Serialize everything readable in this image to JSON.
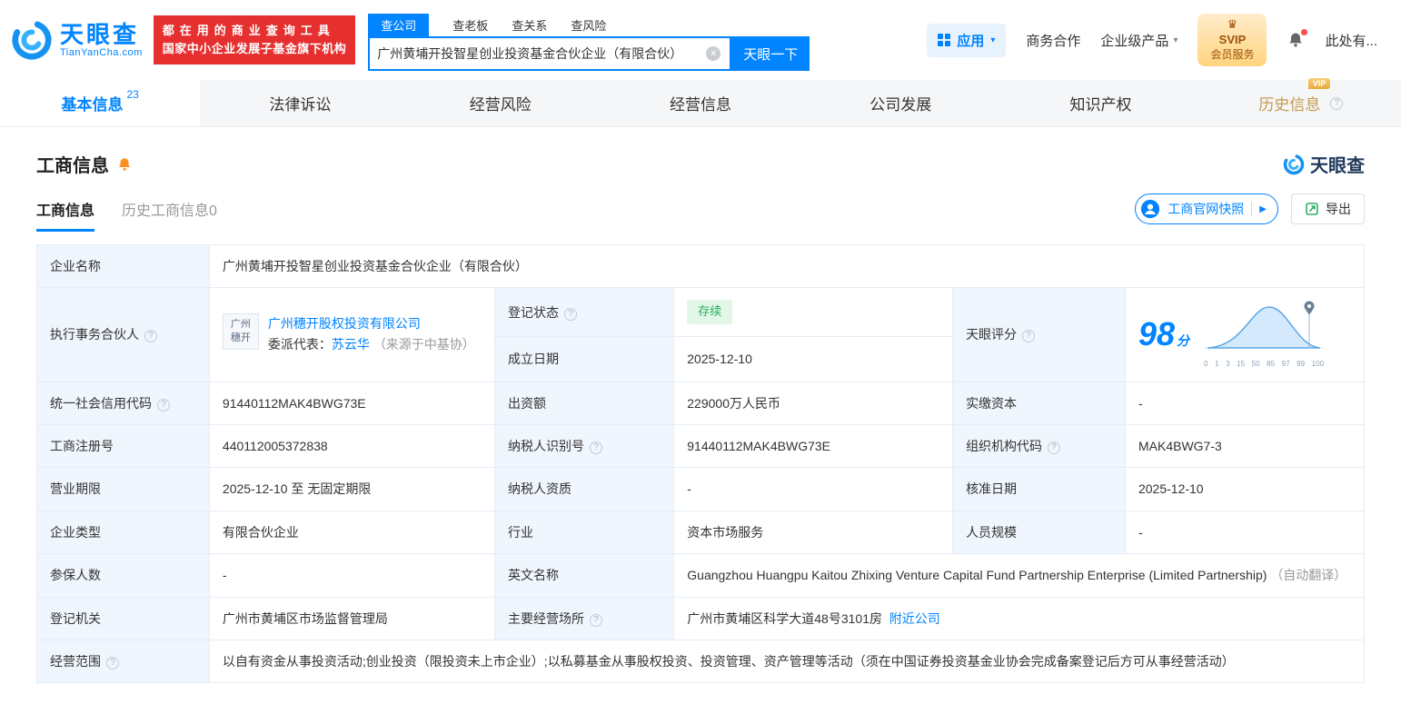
{
  "brand": {
    "name_cn": "天眼查",
    "name_en": "TianYanCha.com"
  },
  "icons": {
    "help": "?",
    "clear": "✕",
    "caret": "▾",
    "snapshot_arrow": "▶",
    "crown": "♛"
  },
  "header": {
    "banner_line1": "都在用的商业查询工具",
    "banner_line2": "国家中小企业发展子基金旗下机构",
    "search_tabs": [
      {
        "label": "查公司"
      },
      {
        "label": "查老板"
      },
      {
        "label": "查关系"
      },
      {
        "label": "查风险"
      }
    ],
    "search_value": "广州黄埔开投智星创业投资基金合伙企业（有限合伙）",
    "search_button": "天眼一下",
    "apps_label": "应用",
    "biz_coop": "商务合作",
    "enterprise_products": "企业级产品",
    "svip_top": "SVIP",
    "svip_bottom": "会员服务",
    "user_text": "此处有..."
  },
  "nav": {
    "tabs": [
      {
        "label": "基本信息",
        "count": "23"
      },
      {
        "label": "法律诉讼"
      },
      {
        "label": "经营风险"
      },
      {
        "label": "经营信息"
      },
      {
        "label": "公司发展"
      },
      {
        "label": "知识产权"
      },
      {
        "label": "历史信息",
        "vip": "VIP"
      }
    ]
  },
  "section": {
    "title": "工商信息",
    "brand_logo_text": "天眼查",
    "subtabs": [
      {
        "label": "工商信息"
      },
      {
        "label": "历史工商信息0"
      }
    ],
    "snapshot_button": "工商官网快照",
    "export_button": "导出"
  },
  "table": {
    "company_name": {
      "label": "企业名称",
      "value": "广州黄埔开投智星创业投资基金合伙企业（有限合伙）"
    },
    "partner": {
      "label": "执行事务合伙人",
      "logo_line1": "广州",
      "logo_line2": "穗开",
      "company": "广州穗开股权投资有限公司",
      "rep_label": "委派代表：",
      "rep_name": "苏云华",
      "rep_source": "（来源于中基协）"
    },
    "reg_status": {
      "label": "登记状态",
      "value": "存续"
    },
    "est_date": {
      "label": "成立日期",
      "value": "2025-12-10"
    },
    "score": {
      "label": "天眼评分",
      "value": "98",
      "unit": "分",
      "axis": [
        "0",
        "1",
        "3",
        "15",
        "50",
        "85",
        "97",
        "99",
        "100"
      ]
    },
    "credit_code": {
      "label": "统一社会信用代码",
      "value": "91440112MAK4BWG73E"
    },
    "capital": {
      "label": "出资额",
      "value": "229000万人民币"
    },
    "paid_capital": {
      "label": "实缴资本",
      "value": "-"
    },
    "reg_no": {
      "label": "工商注册号",
      "value": "440112005372838"
    },
    "taxpayer_no": {
      "label": "纳税人识别号",
      "value": "91440112MAK4BWG73E"
    },
    "org_code": {
      "label": "组织机构代码",
      "value": "MAK4BWG7-3"
    },
    "term": {
      "label": "营业期限",
      "value": "2025-12-10 至 无固定期限"
    },
    "taxpayer_qual": {
      "label": "纳税人资质",
      "value": "-"
    },
    "approval_date": {
      "label": "核准日期",
      "value": "2025-12-10"
    },
    "company_type": {
      "label": "企业类型",
      "value": "有限合伙企业"
    },
    "industry": {
      "label": "行业",
      "value": "资本市场服务"
    },
    "staff_size": {
      "label": "人员规模",
      "value": "-"
    },
    "insured": {
      "label": "参保人数",
      "value": "-"
    },
    "english_name": {
      "label": "英文名称",
      "value": "Guangzhou Huangpu Kaitou Zhixing Venture Capital Fund Partnership Enterprise (Limited Partnership)",
      "note": "（自动翻译）"
    },
    "reg_authority": {
      "label": "登记机关",
      "value": "广州市黄埔区市场监督管理局"
    },
    "address": {
      "label": "主要经营场所",
      "value": "广州市黄埔区科学大道48号3101房",
      "link": "附近公司"
    },
    "scope": {
      "label": "经营范围",
      "value": "以自有资金从事投资活动;创业投资（限投资未上市企业）;以私募基金从事股权投资、投资管理、资产管理等活动（须在中国证券投资基金业协会完成备案登记后方可从事经营活动）"
    }
  }
}
